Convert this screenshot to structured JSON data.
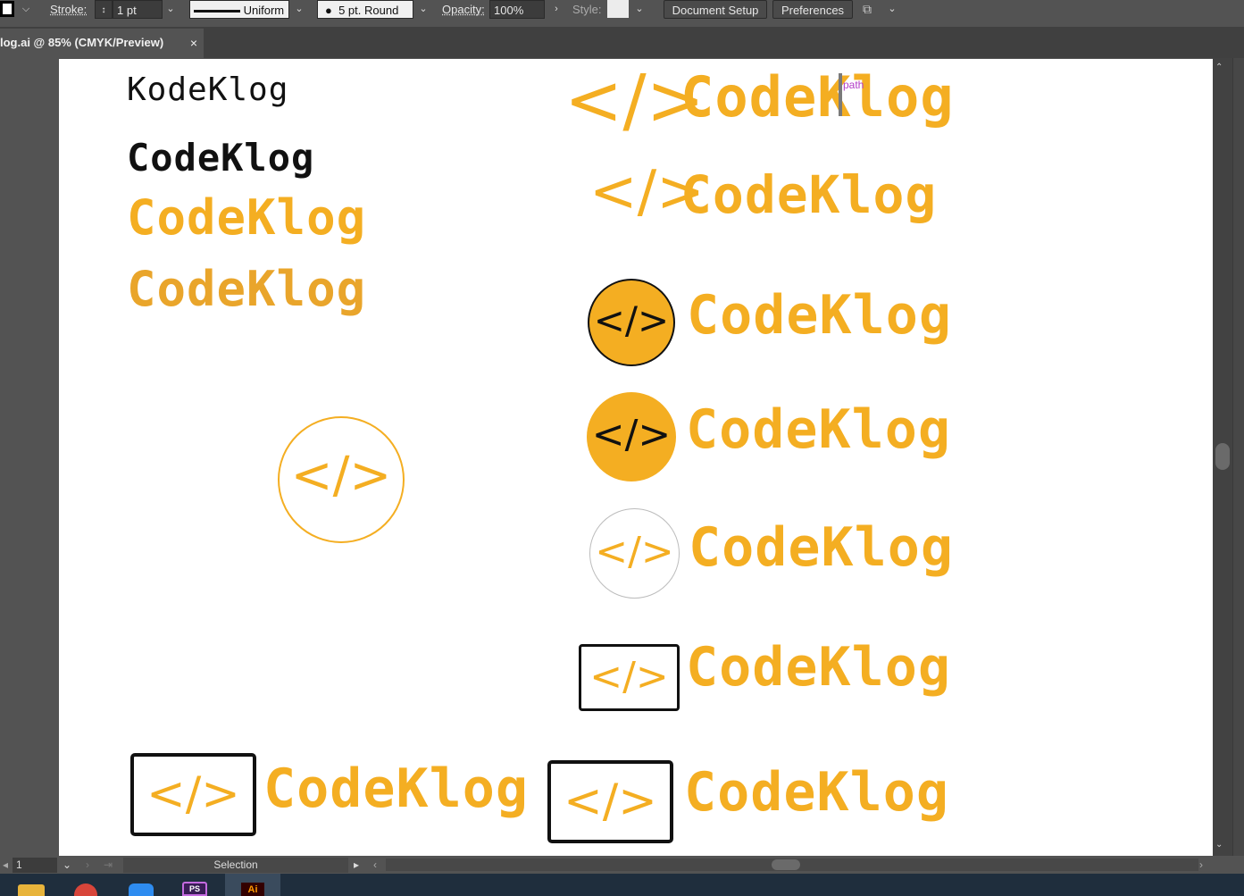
{
  "control_bar": {
    "stroke_label": "Stroke:",
    "stroke_weight": "1 pt",
    "stroke_profile": "Uniform",
    "brush": "5 pt. Round",
    "opacity_label": "Opacity:",
    "opacity_value": "100%",
    "style_label": "Style:",
    "document_setup": "Document Setup",
    "preferences": "Preferences"
  },
  "tab": {
    "title": "log.ai @ 85% (CMYK/Preview)",
    "close": "×"
  },
  "artboard": {
    "hover_hint": "path",
    "logos": {
      "kodeklog": "KodeKlog",
      "name": "CodeKlog",
      "symbol": "</>"
    }
  },
  "status_bar": {
    "artboard_number": "1",
    "tool": "Selection"
  },
  "colors": {
    "accent": "#f4ae22",
    "ui_bg": "#535353",
    "tab_bg": "#404040",
    "taskbar": "#1f2e3d"
  }
}
